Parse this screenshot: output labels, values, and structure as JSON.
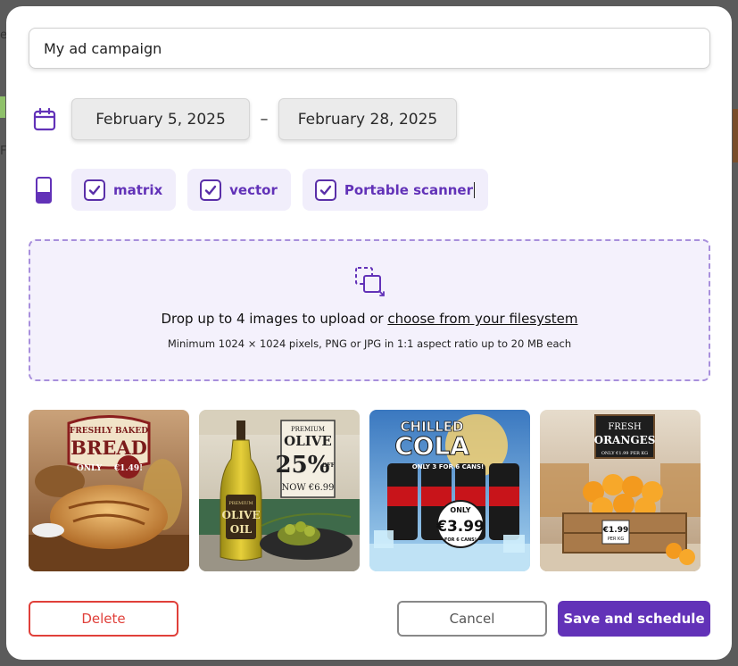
{
  "background": {
    "frag_top": "e",
    "frag_left": "F"
  },
  "campaign": {
    "name": "My ad campaign"
  },
  "dates": {
    "start": "February 5, 2025",
    "separator": "–",
    "end": "February 28, 2025"
  },
  "devices": [
    {
      "label": "matrix",
      "checked": true
    },
    {
      "label": "vector",
      "checked": true
    },
    {
      "label": "Portable scanner",
      "checked": true
    }
  ],
  "upload": {
    "text_before": "Drop up to 4 images to upload or ",
    "link": "choose from your filesystem",
    "hint": "Minimum 1024 × 1024 pixels, PNG or JPG in 1:1 aspect ratio up to 20 MB each"
  },
  "images": [
    {
      "name": "bread",
      "lines": [
        "FRESHLY BAKED",
        "BREAD",
        "ONLY",
        "€1.49!"
      ]
    },
    {
      "name": "olive-oil",
      "lines": [
        "PREMIUM",
        "OLIVE",
        "25%",
        "OFF",
        "NOW €6.99",
        "PREMIUM",
        "OLIVE",
        "OIL"
      ]
    },
    {
      "name": "cola",
      "lines": [
        "CHILLED",
        "COLA",
        "ONLY 3 FOR 6 CANS!",
        "ONLY",
        "€3.99",
        "FOR 6 CANS!"
      ]
    },
    {
      "name": "oranges",
      "lines": [
        "FRESH",
        "ORANGES",
        "ONLY €1.99 PER KG",
        "€1.99",
        "PER KG"
      ]
    }
  ],
  "actions": {
    "delete": "Delete",
    "cancel": "Cancel",
    "save": "Save and schedule"
  },
  "colors": {
    "accent": "#6232b8",
    "danger": "#e0403a",
    "chip_bg": "#f1eefb"
  }
}
